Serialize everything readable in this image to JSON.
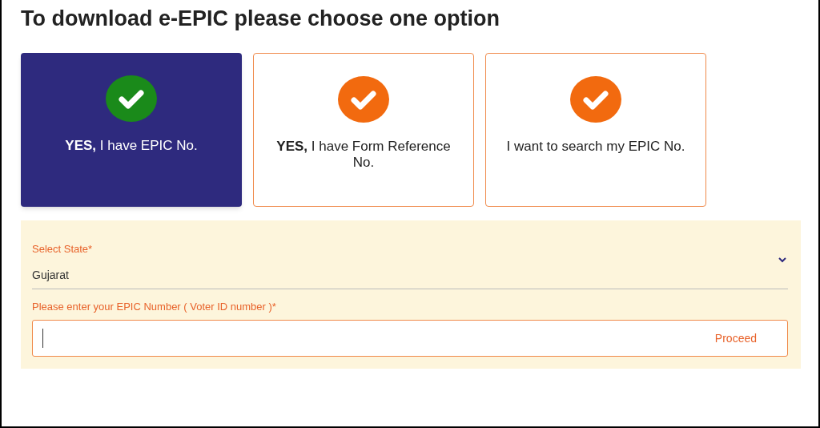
{
  "heading": "To download e-EPIC please choose one option",
  "options": [
    {
      "label": "**YES,** I have EPIC No.",
      "selected": true
    },
    {
      "label": "**YES,** I have Form Reference No.",
      "selected": false
    },
    {
      "label": "I want to search my EPIC No.",
      "selected": false
    }
  ],
  "state_select": {
    "label": "Select State",
    "required_mark": "*",
    "value": "Gujarat"
  },
  "epic_field": {
    "label": "Please enter your EPIC Number ( Voter ID number )",
    "required_mark": "*",
    "button": "Proceed"
  }
}
